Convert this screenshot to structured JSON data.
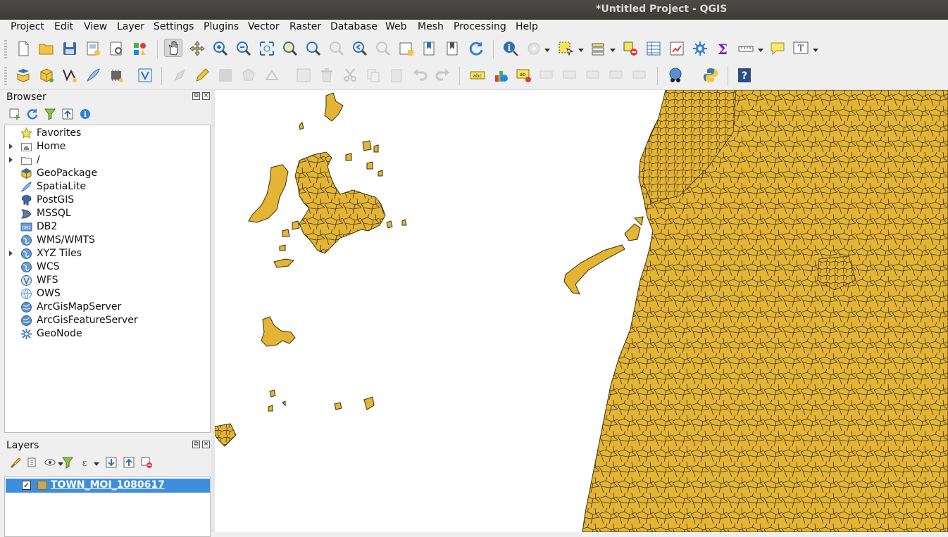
{
  "window": {
    "title": "*Untitled Project - QGIS"
  },
  "menu": [
    "Project",
    "Edit",
    "View",
    "Layer",
    "Settings",
    "Plugins",
    "Vector",
    "Raster",
    "Database",
    "Web",
    "Mesh",
    "Processing",
    "Help"
  ],
  "browser": {
    "title": "Browser",
    "items": [
      {
        "label": "Favorites",
        "icon": "star-icon",
        "expandable": false
      },
      {
        "label": "Home",
        "icon": "home-folder-icon",
        "expandable": true
      },
      {
        "label": "/",
        "icon": "folder-icon",
        "expandable": true
      },
      {
        "label": "GeoPackage",
        "icon": "geopackage-icon",
        "expandable": false
      },
      {
        "label": "SpatiaLite",
        "icon": "spatialite-feather-icon",
        "expandable": false
      },
      {
        "label": "PostGIS",
        "icon": "postgis-elephant-icon",
        "expandable": false
      },
      {
        "label": "MSSQL",
        "icon": "mssql-icon",
        "expandable": false
      },
      {
        "label": "DB2",
        "icon": "db2-icon",
        "expandable": false
      },
      {
        "label": "WMS/WMTS",
        "icon": "globe-icon",
        "expandable": false
      },
      {
        "label": "XYZ Tiles",
        "icon": "globe-icon",
        "expandable": true
      },
      {
        "label": "WCS",
        "icon": "globe-icon",
        "expandable": false
      },
      {
        "label": "WFS",
        "icon": "wfs-globe-icon",
        "expandable": false
      },
      {
        "label": "OWS",
        "icon": "ows-globe-icon",
        "expandable": false
      },
      {
        "label": "ArcGisMapServer",
        "icon": "arcgis-globe-icon",
        "expandable": false
      },
      {
        "label": "ArcGisFeatureServer",
        "icon": "arcgis-globe-icon",
        "expandable": false
      },
      {
        "label": "GeoNode",
        "icon": "geonode-icon",
        "expandable": false
      }
    ]
  },
  "layers": {
    "title": "Layers",
    "items": [
      {
        "name": "TOWN_MOI_1080617",
        "checked": true,
        "selected": true,
        "swatch_color": "#c1a85a"
      }
    ]
  },
  "map": {
    "fill_color": "#e4b435",
    "stroke_color": "#3a2e10",
    "background": "#ffffff"
  },
  "colors": {
    "selection": "#3e8ede",
    "titlebar": "#3c3b37"
  }
}
